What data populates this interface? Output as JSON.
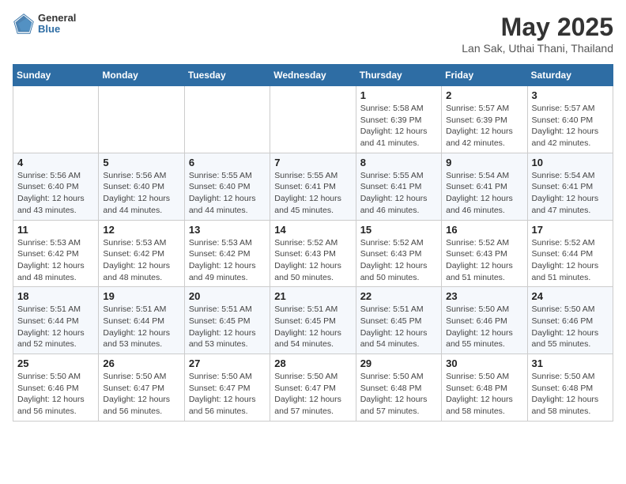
{
  "header": {
    "logo_general": "General",
    "logo_blue": "Blue",
    "month": "May 2025",
    "location": "Lan Sak, Uthai Thani, Thailand"
  },
  "weekdays": [
    "Sunday",
    "Monday",
    "Tuesday",
    "Wednesday",
    "Thursday",
    "Friday",
    "Saturday"
  ],
  "weeks": [
    [
      {
        "day": "",
        "info": ""
      },
      {
        "day": "",
        "info": ""
      },
      {
        "day": "",
        "info": ""
      },
      {
        "day": "",
        "info": ""
      },
      {
        "day": "1",
        "info": "Sunrise: 5:58 AM\nSunset: 6:39 PM\nDaylight: 12 hours\nand 41 minutes."
      },
      {
        "day": "2",
        "info": "Sunrise: 5:57 AM\nSunset: 6:39 PM\nDaylight: 12 hours\nand 42 minutes."
      },
      {
        "day": "3",
        "info": "Sunrise: 5:57 AM\nSunset: 6:40 PM\nDaylight: 12 hours\nand 42 minutes."
      }
    ],
    [
      {
        "day": "4",
        "info": "Sunrise: 5:56 AM\nSunset: 6:40 PM\nDaylight: 12 hours\nand 43 minutes."
      },
      {
        "day": "5",
        "info": "Sunrise: 5:56 AM\nSunset: 6:40 PM\nDaylight: 12 hours\nand 44 minutes."
      },
      {
        "day": "6",
        "info": "Sunrise: 5:55 AM\nSunset: 6:40 PM\nDaylight: 12 hours\nand 44 minutes."
      },
      {
        "day": "7",
        "info": "Sunrise: 5:55 AM\nSunset: 6:41 PM\nDaylight: 12 hours\nand 45 minutes."
      },
      {
        "day": "8",
        "info": "Sunrise: 5:55 AM\nSunset: 6:41 PM\nDaylight: 12 hours\nand 46 minutes."
      },
      {
        "day": "9",
        "info": "Sunrise: 5:54 AM\nSunset: 6:41 PM\nDaylight: 12 hours\nand 46 minutes."
      },
      {
        "day": "10",
        "info": "Sunrise: 5:54 AM\nSunset: 6:41 PM\nDaylight: 12 hours\nand 47 minutes."
      }
    ],
    [
      {
        "day": "11",
        "info": "Sunrise: 5:53 AM\nSunset: 6:42 PM\nDaylight: 12 hours\nand 48 minutes."
      },
      {
        "day": "12",
        "info": "Sunrise: 5:53 AM\nSunset: 6:42 PM\nDaylight: 12 hours\nand 48 minutes."
      },
      {
        "day": "13",
        "info": "Sunrise: 5:53 AM\nSunset: 6:42 PM\nDaylight: 12 hours\nand 49 minutes."
      },
      {
        "day": "14",
        "info": "Sunrise: 5:52 AM\nSunset: 6:43 PM\nDaylight: 12 hours\nand 50 minutes."
      },
      {
        "day": "15",
        "info": "Sunrise: 5:52 AM\nSunset: 6:43 PM\nDaylight: 12 hours\nand 50 minutes."
      },
      {
        "day": "16",
        "info": "Sunrise: 5:52 AM\nSunset: 6:43 PM\nDaylight: 12 hours\nand 51 minutes."
      },
      {
        "day": "17",
        "info": "Sunrise: 5:52 AM\nSunset: 6:44 PM\nDaylight: 12 hours\nand 51 minutes."
      }
    ],
    [
      {
        "day": "18",
        "info": "Sunrise: 5:51 AM\nSunset: 6:44 PM\nDaylight: 12 hours\nand 52 minutes."
      },
      {
        "day": "19",
        "info": "Sunrise: 5:51 AM\nSunset: 6:44 PM\nDaylight: 12 hours\nand 53 minutes."
      },
      {
        "day": "20",
        "info": "Sunrise: 5:51 AM\nSunset: 6:45 PM\nDaylight: 12 hours\nand 53 minutes."
      },
      {
        "day": "21",
        "info": "Sunrise: 5:51 AM\nSunset: 6:45 PM\nDaylight: 12 hours\nand 54 minutes."
      },
      {
        "day": "22",
        "info": "Sunrise: 5:51 AM\nSunset: 6:45 PM\nDaylight: 12 hours\nand 54 minutes."
      },
      {
        "day": "23",
        "info": "Sunrise: 5:50 AM\nSunset: 6:46 PM\nDaylight: 12 hours\nand 55 minutes."
      },
      {
        "day": "24",
        "info": "Sunrise: 5:50 AM\nSunset: 6:46 PM\nDaylight: 12 hours\nand 55 minutes."
      }
    ],
    [
      {
        "day": "25",
        "info": "Sunrise: 5:50 AM\nSunset: 6:46 PM\nDaylight: 12 hours\nand 56 minutes."
      },
      {
        "day": "26",
        "info": "Sunrise: 5:50 AM\nSunset: 6:47 PM\nDaylight: 12 hours\nand 56 minutes."
      },
      {
        "day": "27",
        "info": "Sunrise: 5:50 AM\nSunset: 6:47 PM\nDaylight: 12 hours\nand 56 minutes."
      },
      {
        "day": "28",
        "info": "Sunrise: 5:50 AM\nSunset: 6:47 PM\nDaylight: 12 hours\nand 57 minutes."
      },
      {
        "day": "29",
        "info": "Sunrise: 5:50 AM\nSunset: 6:48 PM\nDaylight: 12 hours\nand 57 minutes."
      },
      {
        "day": "30",
        "info": "Sunrise: 5:50 AM\nSunset: 6:48 PM\nDaylight: 12 hours\nand 58 minutes."
      },
      {
        "day": "31",
        "info": "Sunrise: 5:50 AM\nSunset: 6:48 PM\nDaylight: 12 hours\nand 58 minutes."
      }
    ]
  ]
}
